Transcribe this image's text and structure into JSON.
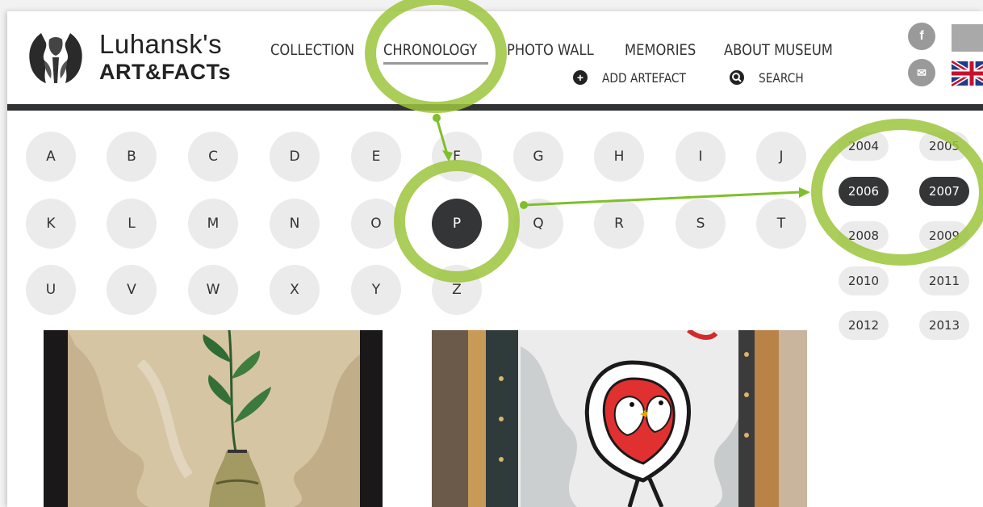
{
  "site": {
    "logo_line1": "Luhansk's",
    "logo_line2": "ART&FACTs"
  },
  "nav": {
    "items": [
      "COLLECTION",
      "CHRONOLOGY",
      "PHOTO WALL",
      "MEMORIES",
      "ABOUT MUSEUM"
    ],
    "active": "CHRONOLOGY"
  },
  "subnav": {
    "add_artefact": "ADD ARTEFACT",
    "search": "SEARCH"
  },
  "social": {
    "facebook": "f",
    "email": "✉"
  },
  "alphabet": {
    "letters": [
      "A",
      "B",
      "C",
      "D",
      "E",
      "F",
      "G",
      "H",
      "I",
      "J",
      "K",
      "L",
      "M",
      "N",
      "O",
      "P",
      "Q",
      "R",
      "S",
      "T",
      "U",
      "V",
      "W",
      "X",
      "Y",
      "Z"
    ],
    "selected": "P"
  },
  "years": {
    "items": [
      "2004",
      "2005",
      "2006",
      "2007",
      "2008",
      "2009",
      "2010",
      "2011",
      "2012",
      "2013"
    ],
    "selected": [
      "2006",
      "2007"
    ]
  },
  "colors": {
    "header_bar": "#2f3133",
    "active_bg": "#333537",
    "inactive_bg": "#ebebeb",
    "annotation": "#9cc43c"
  },
  "icons": {
    "add": "plus-circle-icon",
    "search": "search-icon",
    "facebook": "facebook-icon",
    "email": "email-icon",
    "flag": "uk-flag-icon"
  }
}
